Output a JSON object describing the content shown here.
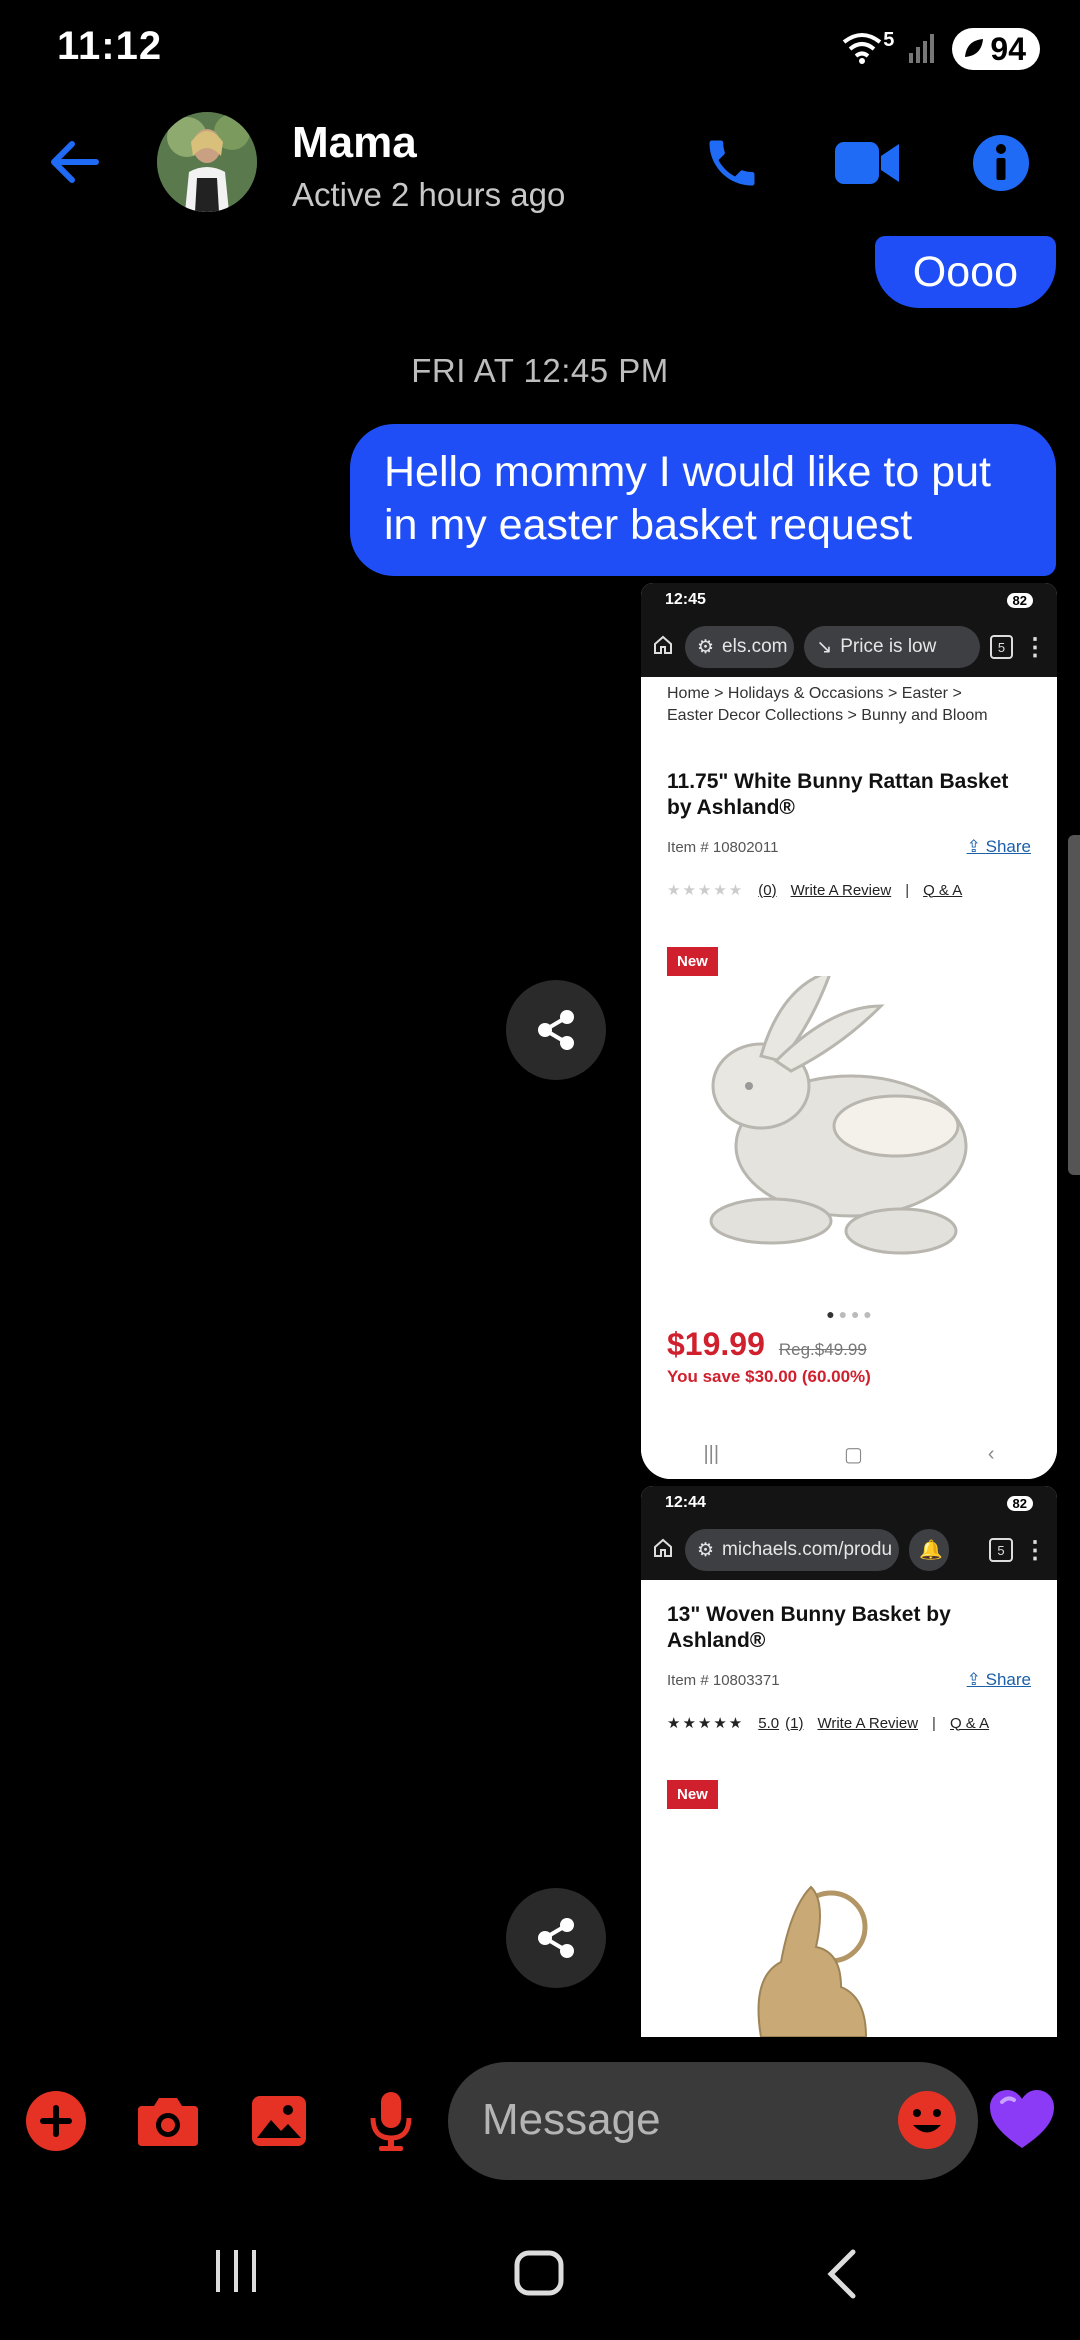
{
  "status_bar": {
    "time": "11:12",
    "wifi_label": "5",
    "battery": "94"
  },
  "header": {
    "name": "Mama",
    "subtitle": "Active 2 hours ago"
  },
  "colors": {
    "accent": "#1f4ef6",
    "red": "#e53224",
    "heart": "#8b3bf5"
  },
  "messages": {
    "prev_bubble": "Oooo",
    "timestamp": "FRI AT 12:45 PM",
    "main_bubble": "Hello mommy I would like to put in my easter basket request"
  },
  "shot1": {
    "time": "12:45",
    "battery": "82",
    "url_pill": "els.com",
    "price_pill": "Price is low",
    "tabs": "5",
    "crumbs_line1": "Home  >  Holidays & Occasions  >  Easter  >",
    "crumbs_line2": "Easter Decor Collections  >  Bunny and Bloom",
    "title": "11.75\" White Bunny Rattan Basket by Ashland®",
    "item_no": "Item # 10802011",
    "share": "Share",
    "reviews": "(0)",
    "write_review": "Write A Review",
    "qa": "Q & A",
    "badge": "New",
    "price": "$19.99",
    "reg_price": "Reg.$49.99",
    "you_save": "You save $30.00 (60.00%)"
  },
  "shot2": {
    "time": "12:44",
    "battery": "82",
    "url_pill": "michaels.com/produ",
    "tabs": "5",
    "title": "13\" Woven Bunny Basket by Ashland®",
    "item_no": "Item # 10803371",
    "share": "Share",
    "rating": "5.0",
    "reviews": "(1)",
    "write_review": "Write A Review",
    "qa": "Q & A",
    "badge": "New"
  },
  "composer": {
    "placeholder": "Message"
  }
}
